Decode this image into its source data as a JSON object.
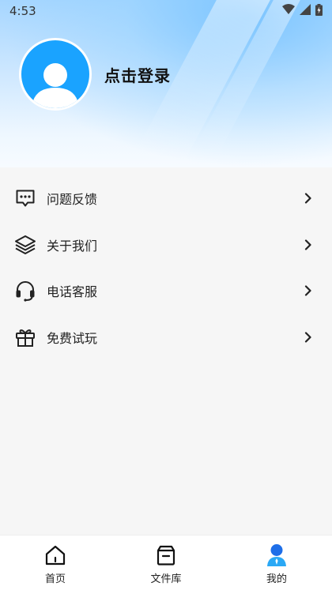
{
  "status_bar": {
    "time": "4:53",
    "icons": [
      "wifi-icon",
      "cellular-signal-icon",
      "battery-charging-icon"
    ]
  },
  "profile": {
    "avatar_icon": "default-user-avatar-icon",
    "login_label": "点击登录"
  },
  "menu": {
    "items": [
      {
        "label": "问题反馈",
        "icon": "message-dots-icon"
      },
      {
        "label": "关于我们",
        "icon": "layers-icon"
      },
      {
        "label": "电话客服",
        "icon": "headset-icon"
      },
      {
        "label": "免费试玩",
        "icon": "gift-icon"
      }
    ]
  },
  "tabbar": {
    "tabs": [
      {
        "label": "首页",
        "icon": "home-icon",
        "active": false
      },
      {
        "label": "文件库",
        "icon": "archive-box-icon",
        "active": false
      },
      {
        "label": "我的",
        "icon": "user-icon",
        "active": true
      }
    ]
  },
  "colors": {
    "accent": "#1aa3ff",
    "hero_gradient_top": "#a6d6ff",
    "background": "#f6f6f6"
  }
}
